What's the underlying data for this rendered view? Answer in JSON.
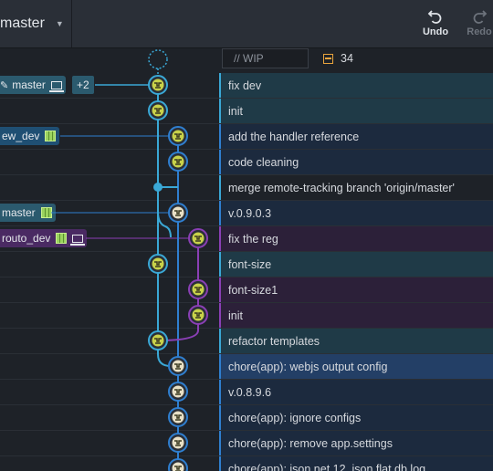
{
  "toolbar": {
    "branch": "master",
    "undo_label": "Undo",
    "redo_label": "Redo"
  },
  "wip": {
    "placeholder": "// WIP",
    "count": "34"
  },
  "refs": {
    "master_local": "master",
    "master_extra": "+2",
    "new_dev": "ew_dev",
    "master_remote": "master",
    "routo_dev": "routo_dev"
  },
  "commits": [
    {
      "message": "fix dev"
    },
    {
      "message": "init"
    },
    {
      "message": "add the handler reference"
    },
    {
      "message": "code cleaning"
    },
    {
      "message": "merge remote-tracking branch 'origin/master'"
    },
    {
      "message": "v.0.9.0.3"
    },
    {
      "message": "fix the reg"
    },
    {
      "message": "font-size"
    },
    {
      "message": "font-size1"
    },
    {
      "message": "init"
    },
    {
      "message": "refactor templates"
    },
    {
      "message": "chore(app): webjs output config"
    },
    {
      "message": "v.0.8.9.6"
    },
    {
      "message": "chore(app): ignore configs"
    },
    {
      "message": "chore(app): remove app.settings"
    },
    {
      "message": "chore(app): json.net 12, json.flat.db.log"
    }
  ],
  "colors": {
    "lane_master": "#3aa8d6",
    "lane_dev": "#2f7fd0",
    "lane_purple": "#8a3fb5",
    "selected_row": "#233f66"
  }
}
